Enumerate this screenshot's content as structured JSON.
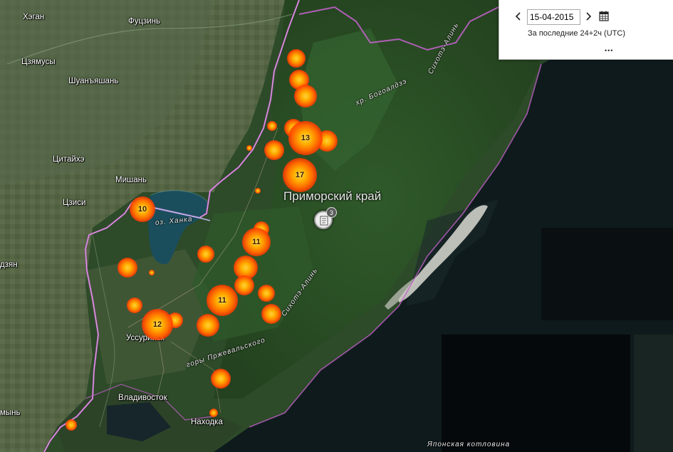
{
  "date_panel": {
    "date_value": "15-04-2015",
    "prev_icon": "chevron-left-icon",
    "next_icon": "chevron-right-icon",
    "calendar_icon": "calendar-icon",
    "period_text": "За последние 24+2ч (UTC)",
    "more_icon": "more-dots-icon",
    "more_label": "•••"
  },
  "cities": [
    {
      "label": "Хэган"
    },
    {
      "label": "Фуцзинь"
    },
    {
      "label": "Цзямусы"
    },
    {
      "label": "Шуанъяшань"
    },
    {
      "label": "Цитайхэ"
    },
    {
      "label": "Мишань"
    },
    {
      "label": "Цзиси"
    },
    {
      "label": "Уссурийск"
    },
    {
      "label": "Владивосток"
    },
    {
      "label": "Находка"
    },
    {
      "label": "дзян"
    },
    {
      "label": "мынь"
    }
  ],
  "region_label": "Приморский край",
  "geo_labels": [
    {
      "label": "оз. Ханка"
    },
    {
      "label": "хр. Богоалдзэ"
    },
    {
      "label": "Сихотэ-Алинь"
    },
    {
      "label": "Сихотэ-Алинь"
    },
    {
      "label": "горы Пржевальского"
    },
    {
      "label": "Японская котловина"
    }
  ],
  "fire_clusters": [
    {
      "count": "13"
    },
    {
      "count": "17"
    },
    {
      "count": "10"
    },
    {
      "count": "11"
    },
    {
      "count": "11"
    },
    {
      "count": "12"
    }
  ],
  "poi": {
    "icon": "document-icon",
    "badge": "3"
  },
  "colors": {
    "border": "#c060c8",
    "fire_core": "#ffd23c",
    "fire_edge": "#ff3c00",
    "sea": "#101a1c",
    "land": "#2e4a2a"
  }
}
